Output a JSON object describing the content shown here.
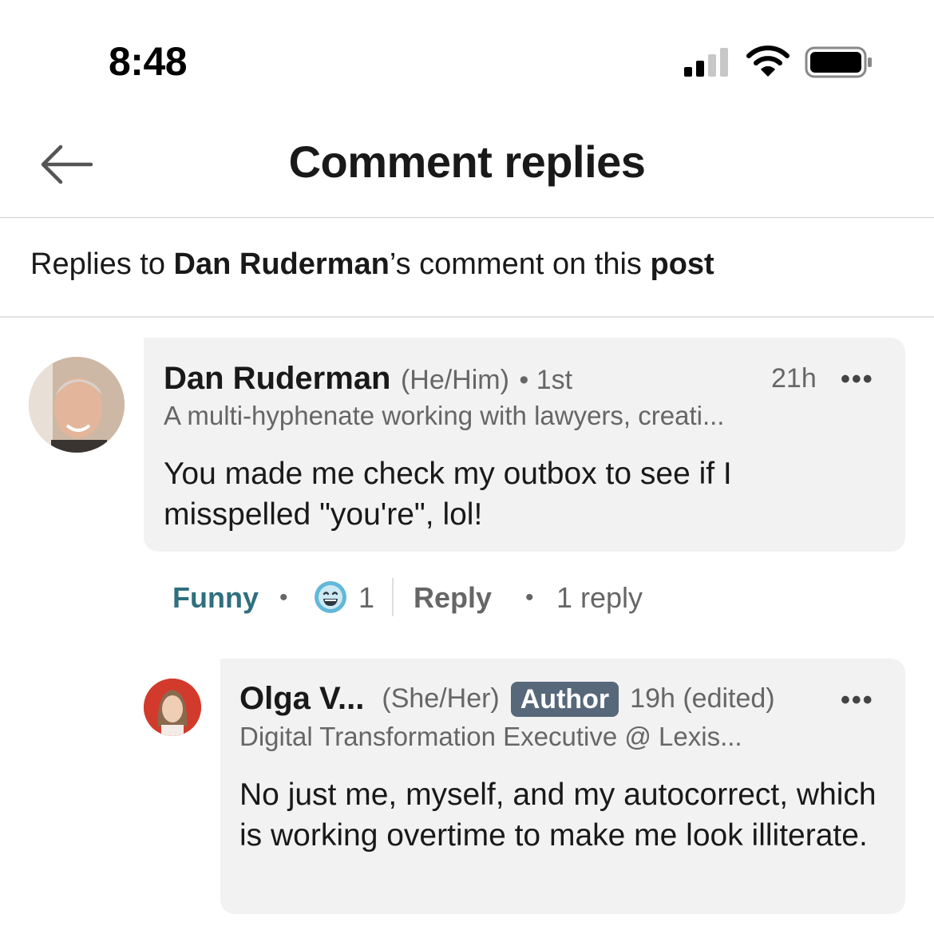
{
  "status_bar": {
    "time": "8:48"
  },
  "header": {
    "title": "Comment replies"
  },
  "context": {
    "prefix": "Replies to ",
    "author": "Dan Ruderman",
    "middle": "’s comment on this ",
    "target": "post"
  },
  "comment": {
    "name": "Dan Ruderman",
    "pronouns": "(He/Him)",
    "degree": "• 1st",
    "time": "21h",
    "more": "•••",
    "headline": "A multi-hyphenate working with lawyers, creati...",
    "text": "You made me check my outbox to see if I misspelled \"you're\", lol!",
    "actions": {
      "reaction_label": "Funny",
      "reaction_count": "1",
      "reply_label": "Reply",
      "reply_count": "1 reply",
      "dot": "•"
    }
  },
  "reply": {
    "name": "Olga V...",
    "pronouns": "(She/Her)",
    "badge": "Author",
    "time": "19h (edited)",
    "more": "•••",
    "headline": "Digital Transformation Executive @ Lexis...",
    "text": "No just me, myself, and my autocorrect, which is working overtime to make me look illiterate."
  },
  "colors": {
    "reaction_accent": "#2f6f7f",
    "author_badge": "#56687a",
    "bubble_bg": "#f2f2f2",
    "secondary_text": "#666666"
  },
  "icons": [
    "signal-icon",
    "wifi-icon",
    "battery-icon",
    "back-arrow-icon",
    "funny-reaction-icon",
    "more-options-icon"
  ]
}
